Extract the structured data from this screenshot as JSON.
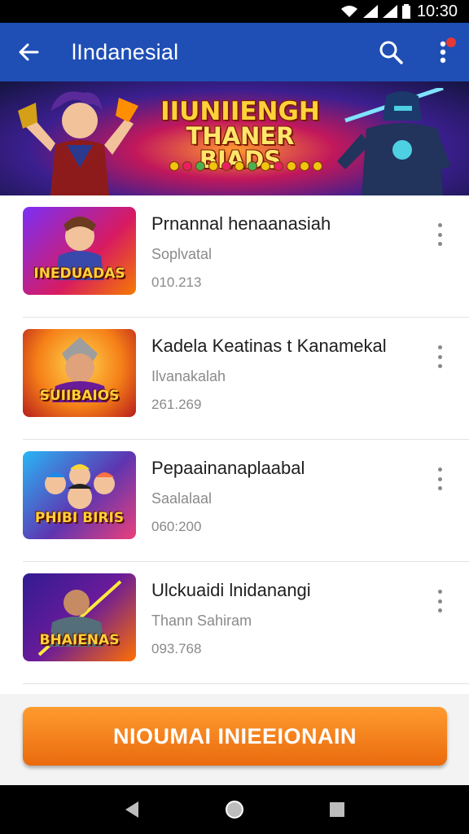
{
  "status_bar": {
    "time": "10:30"
  },
  "app_bar": {
    "title": "lIndanesial"
  },
  "banner": {
    "headline_line1": "IIUNIIENGH",
    "headline_line2": "THANER BIADS"
  },
  "items": [
    {
      "title": "Prnannal henaanasiah",
      "subtitle": "Soplvatal",
      "number": "010.213",
      "thumb_label": "INEDUADAS",
      "thumb_bg": [
        "#7b2ff7",
        "#f57c00"
      ]
    },
    {
      "title": "Kadela Keatinas t Kanamekal",
      "subtitle": "Ilvanakalah",
      "number": "261.269",
      "thumb_label": "SUIIBAIOS",
      "thumb_bg": [
        "#f9a825",
        "#c62828"
      ]
    },
    {
      "title": "Pepaainanaplaabal",
      "subtitle": "Saalalaal",
      "number": "060:200",
      "thumb_label": "PHIBI BIRIS",
      "thumb_bg": [
        "#1e88e5",
        "#8e24aa"
      ]
    },
    {
      "title": "Ulckuaidi lnidanangi",
      "subtitle": "Thann Sahiram",
      "number": "093.768",
      "thumb_label": "BHAIENAS",
      "thumb_bg": [
        "#4527a0",
        "#e65100"
      ]
    }
  ],
  "cta": {
    "label": "NIOUMAI INIEEIONAIN"
  },
  "colors": {
    "app_bar": "#1f4fb5",
    "cta": "#f07a18"
  }
}
